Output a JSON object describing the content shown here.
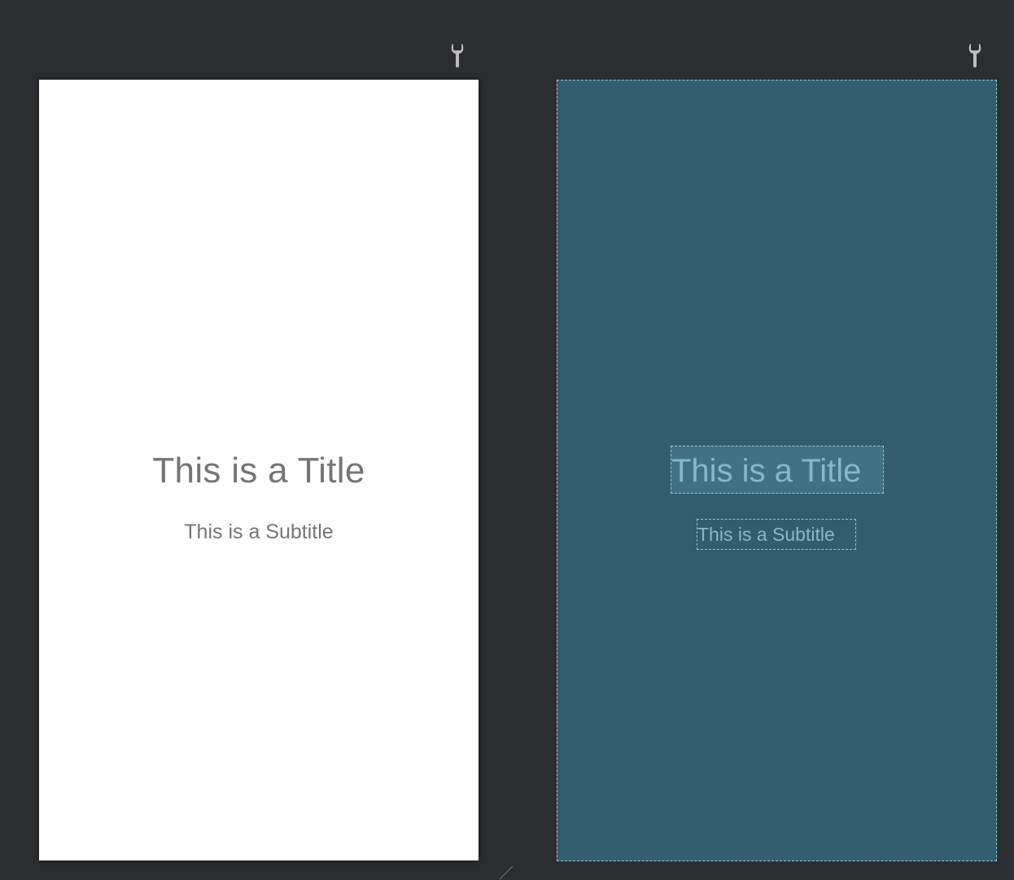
{
  "toolbar": {
    "left_icon": "wrench-icon",
    "right_icon": "wrench-icon"
  },
  "design": {
    "title": "This is a Title",
    "subtitle": "This is a Subtitle"
  },
  "blueprint": {
    "title": "This is a Title",
    "subtitle": "This is a Subtitle"
  },
  "colors": {
    "background": "#2c2d30",
    "design_surface": "#ffffff",
    "text": "#757575",
    "blueprint_surface": "#325d6d",
    "blueprint_outline": "#8ec5d8",
    "blueprint_text": "#86b8c9"
  }
}
